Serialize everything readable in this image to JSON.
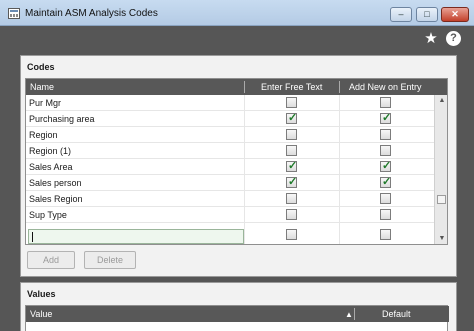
{
  "window": {
    "title": "Maintain ASM Analysis Codes",
    "minimize": "–",
    "maximize": "□",
    "close": "✕"
  },
  "toolbar": {
    "favorite_glyph": "★",
    "help_glyph": "?"
  },
  "codes": {
    "title": "Codes",
    "columns": [
      "Name",
      "Enter Free Text",
      "Add New on Entry"
    ],
    "rows": [
      {
        "name": "Pur Mgr",
        "free_text": false,
        "add_new": false
      },
      {
        "name": "Purchasing area",
        "free_text": true,
        "add_new": true
      },
      {
        "name": "Region",
        "free_text": false,
        "add_new": false
      },
      {
        "name": "Region (1)",
        "free_text": false,
        "add_new": false
      },
      {
        "name": "Sales Area",
        "free_text": true,
        "add_new": true
      },
      {
        "name": "Sales person",
        "free_text": true,
        "add_new": true
      },
      {
        "name": "Sales Region",
        "free_text": false,
        "add_new": false
      },
      {
        "name": "Sup Type",
        "free_text": false,
        "add_new": false
      }
    ],
    "new_row": {
      "name": "",
      "free_text": false,
      "add_new": false
    },
    "add_label": "Add",
    "delete_label": "Delete"
  },
  "values": {
    "title": "Values",
    "columns": [
      "Value",
      "Default"
    ],
    "sort_glyph": "▲"
  }
}
